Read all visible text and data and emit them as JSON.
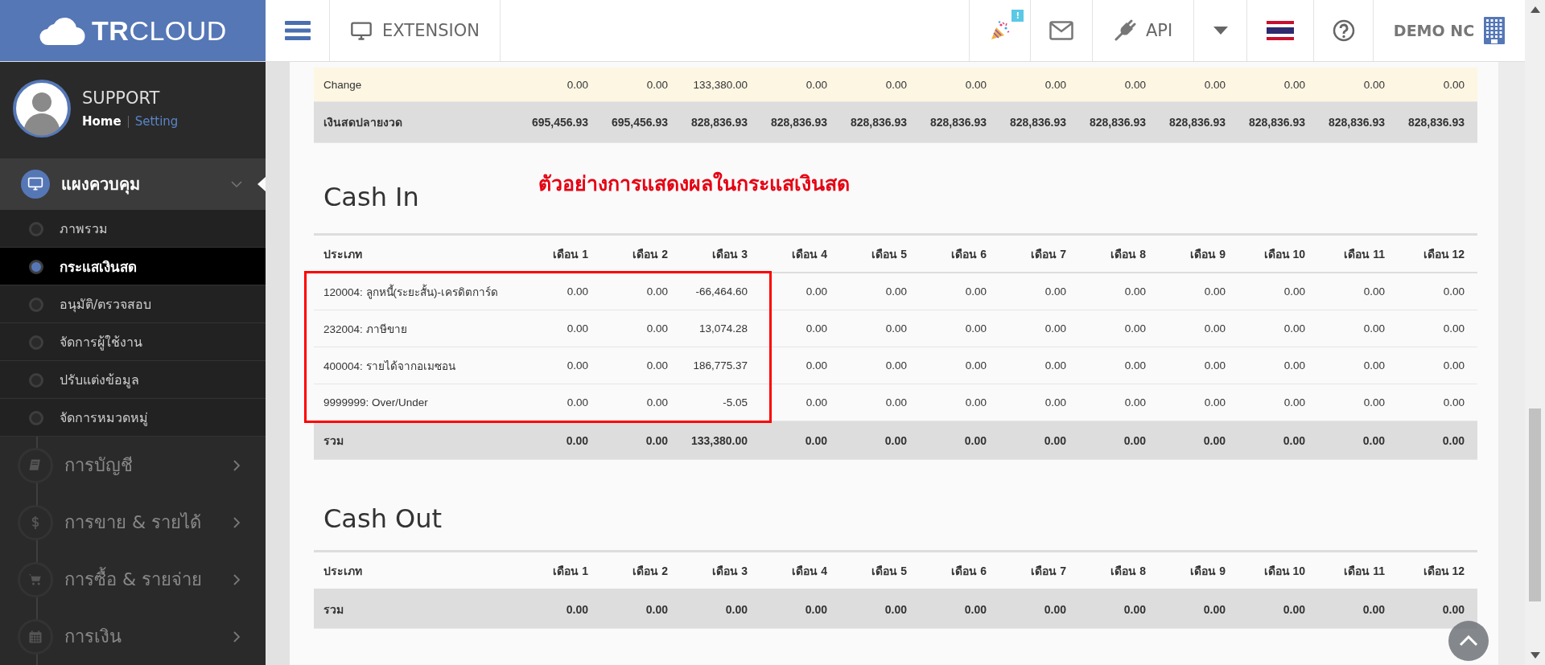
{
  "header": {
    "logo": "**TR**CLOUD",
    "extension": "EXTENSION",
    "notification_badge": "!",
    "api": "API",
    "company": "DEMO NC"
  },
  "user": {
    "name": "SUPPORT",
    "links": [
      {
        "label": "Home",
        "selected": true
      },
      {
        "label": "Setting",
        "selected": false
      }
    ]
  },
  "sidebar": {
    "groups": [
      {
        "label": "แผงควบคุม",
        "expanded": true,
        "children": [
          {
            "label": "ภาพรวม",
            "selected": false
          },
          {
            "label": "กระแสเงินสด",
            "selected": true
          },
          {
            "label": "อนุมัติ/ตรวจสอบ",
            "selected": false
          },
          {
            "label": "จัดการผู้ใช้งาน",
            "selected": false
          },
          {
            "label": "ปรับแต่งข้อมูล",
            "selected": false
          },
          {
            "label": "จัดการหมวดหมู่",
            "selected": false
          }
        ]
      },
      {
        "label": "การบัญชี",
        "expanded": false
      },
      {
        "label": "การขาย & รายได้",
        "expanded": false
      },
      {
        "label": "การซื้อ & รายจ่าย",
        "expanded": false
      },
      {
        "label": "การเงิน",
        "expanded": false
      }
    ]
  },
  "summary_rows": [
    {
      "label": "Change",
      "kind": "change",
      "values": [
        "0.00",
        "0.00",
        "133,380.00",
        "0.00",
        "0.00",
        "0.00",
        "0.00",
        "0.00",
        "0.00",
        "0.00",
        "0.00",
        "0.00"
      ]
    },
    {
      "label": "เงินสดปลายงวด",
      "kind": "balance",
      "values": [
        "695,456.93",
        "695,456.93",
        "828,836.93",
        "828,836.93",
        "828,836.93",
        "828,836.93",
        "828,836.93",
        "828,836.93",
        "828,836.93",
        "828,836.93",
        "828,836.93",
        "828,836.93"
      ]
    }
  ],
  "sections": [
    {
      "title": "Cash In",
      "note": "ตัวอย่างการแสดงผลในกระแสเงินสด",
      "columns": [
        "ประเภท",
        "เดือน 1",
        "เดือน 2",
        "เดือน 3",
        "เดือน 4",
        "เดือน 5",
        "เดือน 6",
        "เดือน 7",
        "เดือน 8",
        "เดือน 9",
        "เดือน 10",
        "เดือน 11",
        "เดือน 12"
      ],
      "rows": [
        {
          "label": "120004: ลูกหนี้(ระยะสั้น)-เครดิตการ์ด",
          "highlighted": true,
          "values": [
            "0.00",
            "0.00",
            "-66,464.60",
            "0.00",
            "0.00",
            "0.00",
            "0.00",
            "0.00",
            "0.00",
            "0.00",
            "0.00",
            "0.00"
          ]
        },
        {
          "label": "232004: ภาษีขาย",
          "highlighted": true,
          "values": [
            "0.00",
            "0.00",
            "13,074.28",
            "0.00",
            "0.00",
            "0.00",
            "0.00",
            "0.00",
            "0.00",
            "0.00",
            "0.00",
            "0.00"
          ]
        },
        {
          "label": "400004: รายได้จากอเมซอน",
          "highlighted": true,
          "values": [
            "0.00",
            "0.00",
            "186,775.37",
            "0.00",
            "0.00",
            "0.00",
            "0.00",
            "0.00",
            "0.00",
            "0.00",
            "0.00",
            "0.00"
          ]
        },
        {
          "label": "9999999: Over/Under",
          "highlighted": true,
          "values": [
            "0.00",
            "0.00",
            "-5.05",
            "0.00",
            "0.00",
            "0.00",
            "0.00",
            "0.00",
            "0.00",
            "0.00",
            "0.00",
            "0.00"
          ]
        }
      ],
      "total": {
        "label": "รวม",
        "values": [
          "0.00",
          "0.00",
          "133,380.00",
          "0.00",
          "0.00",
          "0.00",
          "0.00",
          "0.00",
          "0.00",
          "0.00",
          "0.00",
          "0.00"
        ]
      }
    },
    {
      "title": "Cash Out",
      "columns": [
        "ประเภท",
        "เดือน 1",
        "เดือน 2",
        "เดือน 3",
        "เดือน 4",
        "เดือน 5",
        "เดือน 6",
        "เดือน 7",
        "เดือน 8",
        "เดือน 9",
        "เดือน 10",
        "เดือน 11",
        "เดือน 12"
      ],
      "total": {
        "label": "รวม",
        "values": [
          "0.00",
          "0.00",
          "0.00",
          "0.00",
          "0.00",
          "0.00",
          "0.00",
          "0.00",
          "0.00",
          "0.00",
          "0.00",
          "0.00"
        ]
      }
    }
  ]
}
